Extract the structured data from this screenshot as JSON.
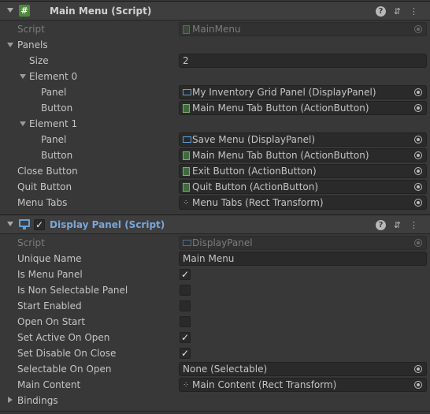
{
  "main_menu": {
    "title": "Main Menu (Script)",
    "script_label": "Script",
    "script_value": "MainMenu",
    "panels_label": "Panels",
    "size_label": "Size",
    "size_value": "2",
    "elements": [
      {
        "label": "Element 0",
        "panel_label": "Panel",
        "panel_value": "My Inventory Grid Panel (DisplayPanel)",
        "button_label": "Button",
        "button_value": "Main Menu Tab Button (ActionButton)"
      },
      {
        "label": "Element 1",
        "panel_label": "Panel",
        "panel_value": "Save Menu (DisplayPanel)",
        "button_label": "Button",
        "button_value": "Main Menu Tab Button (ActionButton)"
      }
    ],
    "close_button_label": "Close Button",
    "close_button_value": "Exit Button (ActionButton)",
    "quit_button_label": "Quit Button",
    "quit_button_value": "Quit Button (ActionButton)",
    "menu_tabs_label": "Menu Tabs",
    "menu_tabs_value": "Menu Tabs (Rect Transform)",
    "script_icon": "hash-script-icon",
    "accent": "#4d8b3a"
  },
  "display_panel": {
    "title": "Display Panel (Script)",
    "title_color": "#7aa6da",
    "enabled": true,
    "script_label": "Script",
    "script_value": "DisplayPanel",
    "unique_name_label": "Unique Name",
    "unique_name_value": "Main Menu",
    "checks": [
      {
        "label": "Is Menu Panel",
        "checked": true
      },
      {
        "label": "Is Non Selectable Panel",
        "checked": false
      },
      {
        "label": "Start Enabled",
        "checked": false
      },
      {
        "label": "Open On Start",
        "checked": false
      },
      {
        "label": "Set Active On Open",
        "checked": true
      },
      {
        "label": "Set Disable On Close",
        "checked": true
      }
    ],
    "selectable_label": "Selectable On Open",
    "selectable_value": "None (Selectable)",
    "main_content_label": "Main Content",
    "main_content_value": "Main Content (Rect Transform)",
    "bindings_label": "Bindings",
    "monitor_icon": "monitor-icon"
  },
  "header_icons": [
    "help-icon",
    "sliders-icon",
    "kebab-menu-icon"
  ],
  "check_glyph": "✓"
}
